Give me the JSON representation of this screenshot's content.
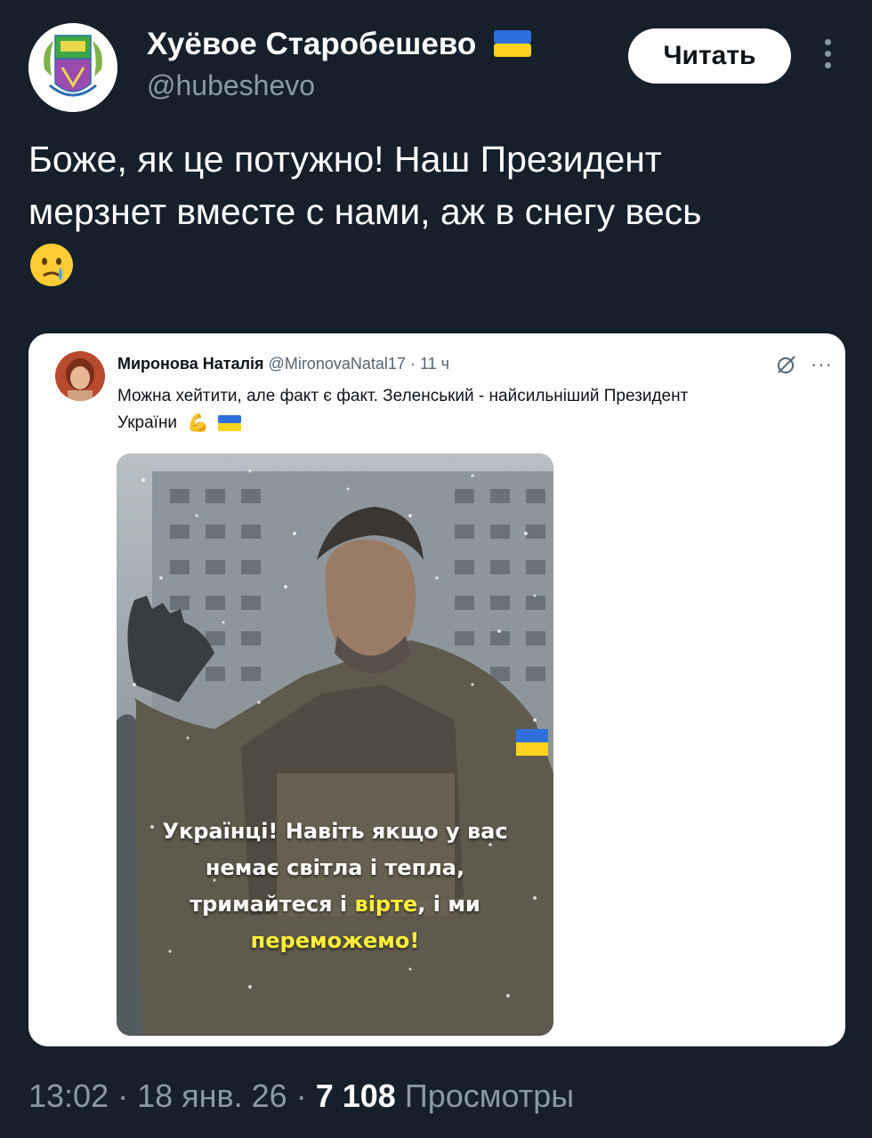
{
  "author": {
    "display_name": "Хуёвое Старобешево",
    "handle": "@hubeshevo",
    "follow_label": "Читать"
  },
  "tweet": {
    "text_line1": "Боже, як це потужно! Наш Президент",
    "text_line2": "мерзнет вместе с нами, аж в снегу весь",
    "emoji": "crying-face-emoji"
  },
  "quoted_tweet": {
    "name": "Миронова Наталія",
    "handle": "@MironovaNatal17",
    "time": "11 ч",
    "text_line1": "Можна хейтити, але факт є факт. Зеленський - найсильніший Президент",
    "text_line2": "України",
    "media_caption": {
      "part1": "Українці! Навіть якщо у вас",
      "part2": "немає світла і тепла,",
      "part3": "тримайтеся і ",
      "highlight1": "вірте",
      "part4": ", і ми",
      "highlight2": "переможемо!"
    }
  },
  "footer": {
    "time": "13:02",
    "date": "18 янв. 26",
    "views_count": "7 108",
    "views_label": "Просмотры"
  },
  "colors": {
    "background": "#15202b",
    "secondary_text": "#8b98a5",
    "flag_blue": "#2f6fdc",
    "flag_yellow": "#ffd21e",
    "highlight_yellow": "#ffef3a"
  }
}
